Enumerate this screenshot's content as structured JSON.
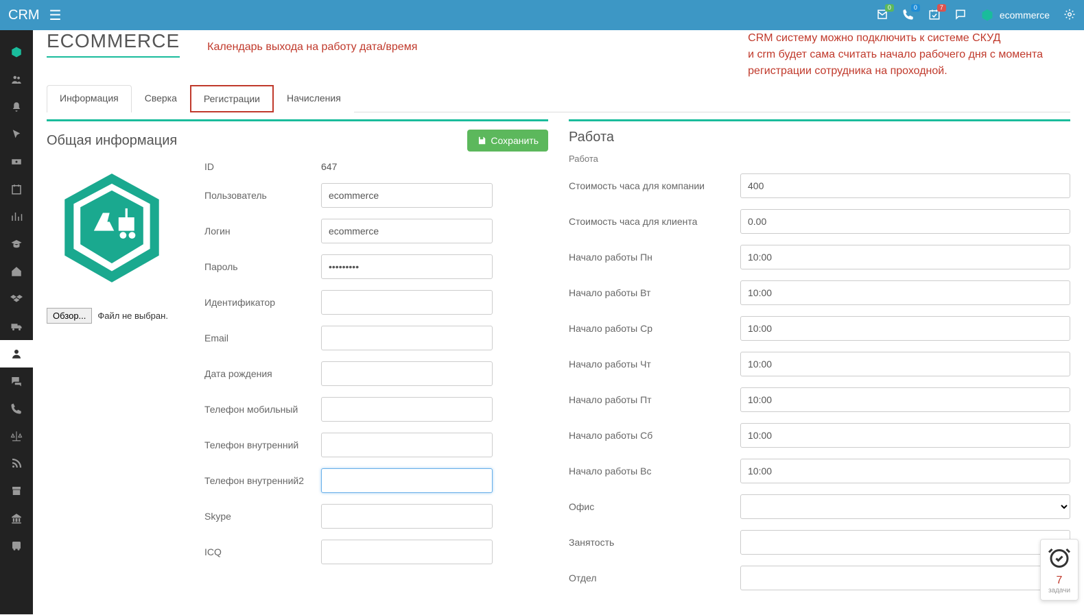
{
  "brand": "CRM",
  "topbar": {
    "badges": {
      "mail": "0",
      "phone": "0",
      "calendar": "7"
    },
    "username": "ecommerce"
  },
  "annotations": {
    "note1": "Календарь выхода на работу дата/время",
    "note2_line1": "CRM систему можно подключить к системе СКУД",
    "note2_line2": "и crm будет сама считать начало рабочего дня с момента",
    "note2_line3": "регистрации сотрудника на проходной."
  },
  "page_title": "ECOMMERCE",
  "tabs": [
    {
      "label": "Информация",
      "key": "info"
    },
    {
      "label": "Сверка",
      "key": "sverka"
    },
    {
      "label": "Регистрации",
      "key": "reg"
    },
    {
      "label": "Начисления",
      "key": "nachisl"
    }
  ],
  "left_panel": {
    "title": "Общая информация",
    "save_label": "Сохранить",
    "file_button": "Обзор...",
    "file_status": "Файл не выбран.",
    "fields": {
      "id_label": "ID",
      "id_value": "647",
      "user_label": "Пользователь",
      "user_value": "ecommerce",
      "login_label": "Логин",
      "login_value": "ecommerce",
      "password_label": "Пароль",
      "password_value": "•••••••••",
      "ident_label": "Идентификатор",
      "ident_value": "",
      "email_label": "Email",
      "email_value": "",
      "dob_label": "Дата рождения",
      "dob_value": "",
      "mobile_label": "Телефон мобильный",
      "mobile_value": "",
      "int_label": "Телефон внутренний",
      "int_value": "",
      "int2_label": "Телефон внутренний2",
      "int2_value": "",
      "skype_label": "Skype",
      "skype_value": "",
      "icq_label": "ICQ",
      "icq_value": ""
    }
  },
  "right_panel": {
    "title": "Работа",
    "section": "Работа",
    "fields": {
      "cost_company_label": "Стоимость часа для компании",
      "cost_company_value": "400",
      "cost_client_label": "Стоимость часа для клиента",
      "cost_client_value": "0.00",
      "mon_label": "Начало работы Пн",
      "mon_value": "10:00",
      "tue_label": "Начало работы Вт",
      "tue_value": "10:00",
      "wed_label": "Начало работы Ср",
      "wed_value": "10:00",
      "thu_label": "Начало работы Чт",
      "thu_value": "10:00",
      "fri_label": "Начало работы Пт",
      "fri_value": "10:00",
      "sat_label": "Начало работы Сб",
      "sat_value": "10:00",
      "sun_label": "Начало работы Вс",
      "sun_value": "10:00",
      "office_label": "Офис",
      "busy_label": "Занятость",
      "dept_label": "Отдел"
    }
  },
  "float_widget": {
    "count": "7",
    "label": "задачи"
  }
}
